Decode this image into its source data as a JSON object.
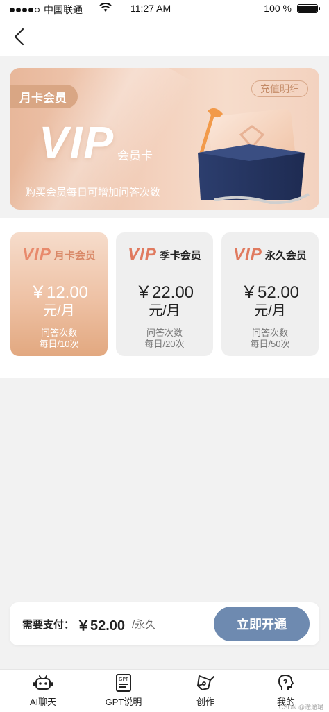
{
  "status_bar": {
    "carrier": "中国联通",
    "time": "11:27 AM",
    "battery": "100 %"
  },
  "banner": {
    "tag": "月卡会员",
    "recharge_detail": "充值明细",
    "vip_logo": "VIP",
    "card_label": "会员卡",
    "description": "购买会员每日可增加问答次数",
    "accent": "#d9a684"
  },
  "plans": [
    {
      "logo": "VIP",
      "name": "月卡会员",
      "price": "￥12.00",
      "unit": "元/月",
      "q_label": "问答次数",
      "q_value": "每日/10次"
    },
    {
      "logo": "VIP",
      "name": "季卡会员",
      "price": "￥22.00",
      "unit": "元/月",
      "q_label": "问答次数",
      "q_value": "每日/20次"
    },
    {
      "logo": "VIP",
      "name": "永久会员",
      "price": "￥52.00",
      "unit": "元/月",
      "q_label": "问答次数",
      "q_value": "每日/50次"
    }
  ],
  "payment": {
    "label": "需要支付：",
    "amount": "￥52.00",
    "unit": "/永久",
    "button": "立即开通",
    "button_color": "#6e8ab0"
  },
  "tabbar": {
    "items": [
      {
        "label": "AI聊天",
        "icon": "robot-icon"
      },
      {
        "label": "GPT说明",
        "icon": "document-icon"
      },
      {
        "label": "创作",
        "icon": "pen-icon"
      },
      {
        "label": "我的",
        "icon": "user-head-icon"
      }
    ]
  },
  "watermark": "CSDN @途途珺"
}
